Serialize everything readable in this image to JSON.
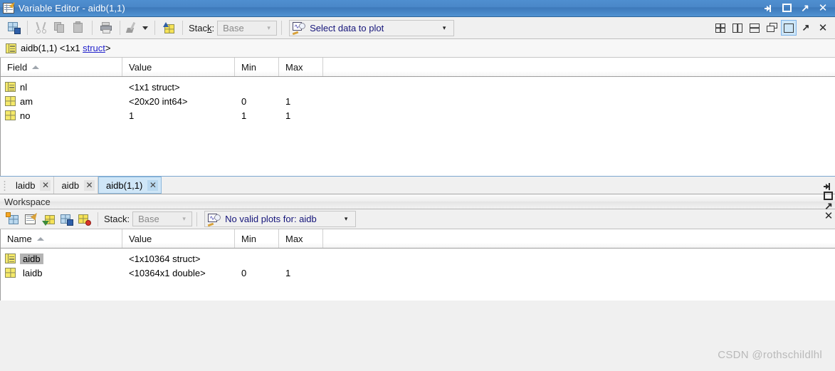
{
  "variable_editor": {
    "title": "Variable Editor - aidb(1,1)",
    "title_icon": "variable-editor-icon",
    "window_buttons": [
      {
        "name": "minimize-button",
        "glyph": "minimize"
      },
      {
        "name": "maximize-button",
        "glyph": "maximize"
      },
      {
        "name": "undock-button",
        "glyph": "↗"
      },
      {
        "name": "close-button",
        "glyph": "✕"
      }
    ],
    "toolbar": {
      "buttons": [
        {
          "name": "save-variable-button",
          "icon": "save-variable-icon",
          "enabled": true
        },
        {
          "name": "cut-button",
          "icon": "scissors-icon",
          "enabled": false
        },
        {
          "name": "copy-button",
          "icon": "copy-icon",
          "enabled": false
        },
        {
          "name": "paste-button",
          "icon": "paste-icon",
          "enabled": false
        },
        {
          "name": "print-button",
          "icon": "printer-icon",
          "enabled": false
        },
        {
          "name": "format-brush-button",
          "icon": "paintbrush-icon",
          "enabled": false
        },
        {
          "name": "insert-button",
          "icon": "insert-grid-icon",
          "enabled": true
        }
      ],
      "stack_label": "Stack:",
      "stack_mnemonic": "k",
      "stack_value": "Base",
      "plot_selector": "Select data to plot"
    },
    "dock_controls": [
      {
        "name": "tile-grid-button",
        "glyph": "grid4"
      },
      {
        "name": "tile-vertical-button",
        "glyph": "vsplit"
      },
      {
        "name": "tile-horizontal-button",
        "glyph": "hsplit"
      },
      {
        "name": "cascade-button",
        "glyph": "cascade"
      },
      {
        "name": "single-pane-button",
        "glyph": "single",
        "selected": true
      },
      {
        "name": "undock-panel-button",
        "glyph": "↗"
      },
      {
        "name": "close-panel-button",
        "glyph": "✕"
      }
    ],
    "path_bar": {
      "icon": "struct-icon",
      "prefix": "aidb(1,1) <1x1 ",
      "link": "struct",
      "suffix": ">"
    },
    "table": {
      "columns": [
        "Field",
        "Value",
        "Min",
        "Max"
      ],
      "sort_column": "Field",
      "sort_direction": "asc",
      "rows": [
        {
          "icon": "struct-icon",
          "name": "nl",
          "value": "<1x1 struct>",
          "min": "",
          "max": ""
        },
        {
          "icon": "matrix-icon",
          "name": "am",
          "value": "<20x20 int64>",
          "min": "0",
          "max": "1"
        },
        {
          "icon": "matrix-icon",
          "name": "no",
          "value": "1",
          "min": "1",
          "max": "1"
        }
      ]
    },
    "tabs": [
      {
        "label": "laidb",
        "active": false,
        "close": "✕"
      },
      {
        "label": "aidb",
        "active": false,
        "close": "✕"
      },
      {
        "label": "aidb(1,1)",
        "active": true,
        "close": "✕"
      }
    ]
  },
  "workspace": {
    "title": "Workspace",
    "window_buttons": [
      {
        "name": "minimize-button",
        "glyph": "minimize"
      },
      {
        "name": "maximize-button",
        "glyph": "maximize"
      },
      {
        "name": "undock-button",
        "glyph": "↗"
      },
      {
        "name": "close-button",
        "glyph": "✕"
      }
    ],
    "toolbar": {
      "buttons": [
        {
          "name": "new-variable-button",
          "icon": "new-variable-icon"
        },
        {
          "name": "open-variable-button",
          "icon": "open-variable-icon"
        },
        {
          "name": "import-data-button",
          "icon": "import-data-icon"
        },
        {
          "name": "save-workspace-button",
          "icon": "save-workspace-icon"
        },
        {
          "name": "delete-variable-button",
          "icon": "delete-variable-icon"
        }
      ],
      "stack_label": "Stack:",
      "stack_value": "Base",
      "plot_selector": "No valid plots for: aidb"
    },
    "table": {
      "columns": [
        "Name",
        "Value",
        "Min",
        "Max"
      ],
      "sort_column": "Name",
      "sort_direction": "asc",
      "rows": [
        {
          "icon": "struct-icon",
          "name": "aidb",
          "value": "<1x10364 struct>",
          "min": "",
          "max": "",
          "selected": true
        },
        {
          "icon": "matrix-icon",
          "name": "laidb",
          "value": "<10364x1 double>",
          "min": "0",
          "max": "1",
          "selected": false
        }
      ]
    }
  },
  "watermark": "CSDN @rothschildlhl",
  "colors": {
    "titlebar_active": "#4a87c8",
    "tab_active": "#cfe6f7",
    "link": "#2222cc",
    "selection": "#b4b4b4",
    "icon_yellow": "#f5e96a"
  }
}
